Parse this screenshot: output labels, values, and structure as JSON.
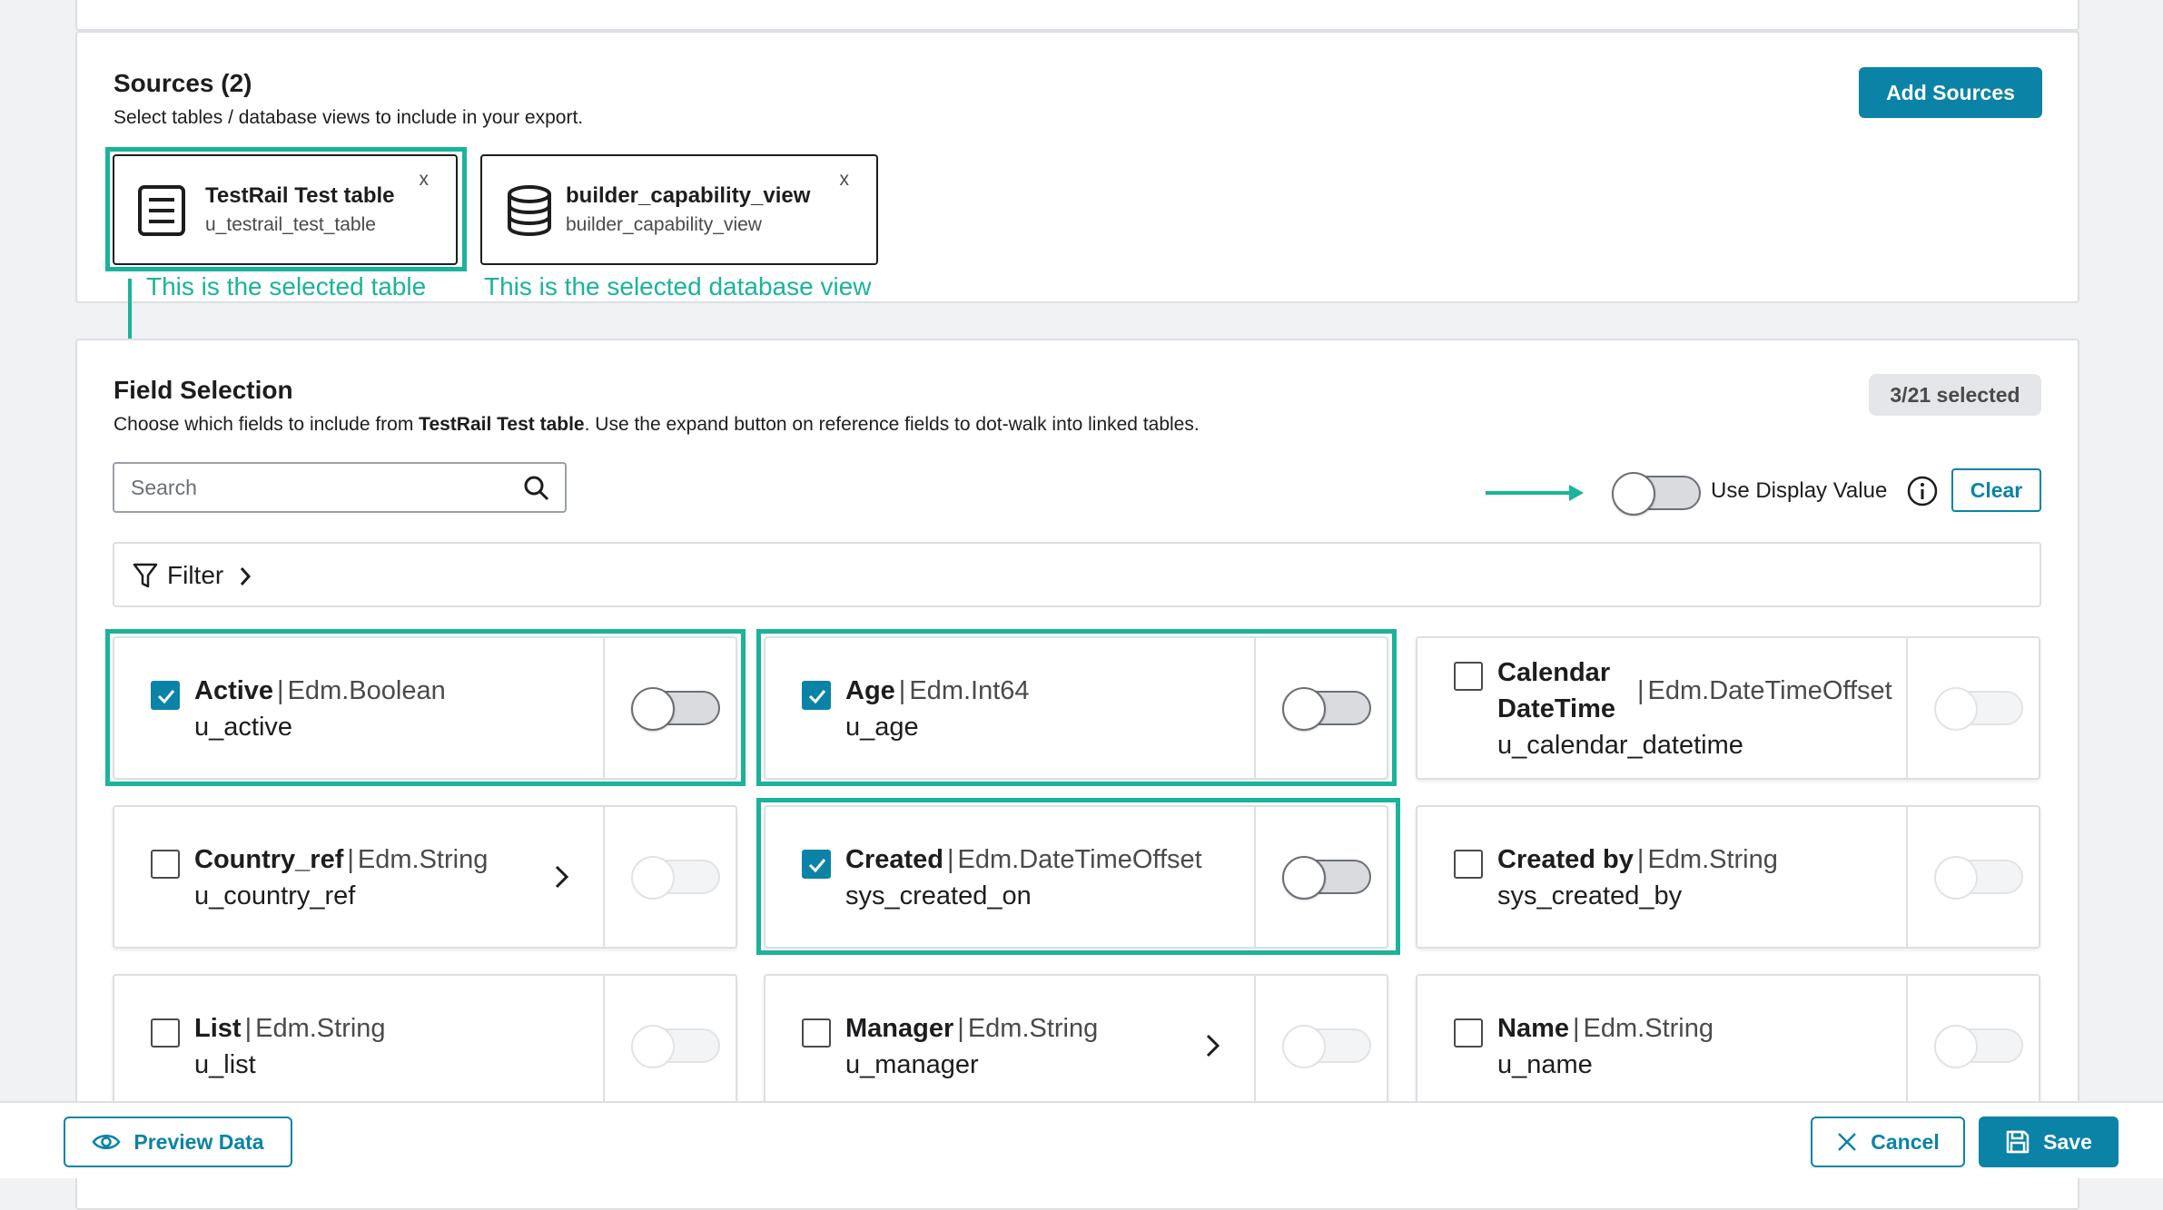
{
  "sources": {
    "title": "Sources (2)",
    "subtitle": "Select tables / database views to include in your export.",
    "add_button": "Add Sources",
    "items": [
      {
        "name": "TestRail Test table",
        "id": "u_testrail_test_table",
        "close": "x",
        "icon": "table-icon"
      },
      {
        "name": "builder_capability_view",
        "id": "builder_capability_view",
        "close": "x",
        "icon": "database-icon"
      }
    ]
  },
  "annotations": {
    "table": "This is the selected table",
    "view": "This is the selected database view",
    "highlight_color": "#1bb39a"
  },
  "fields": {
    "title": "Field Selection",
    "subtitle_pre": "Choose which fields to include from ",
    "subtitle_table": "TestRail Test table",
    "subtitle_post": ". Use the expand button on reference fields to dot-walk into linked tables.",
    "selected_badge": "3/21 selected",
    "search_placeholder": "Search",
    "display_value_label": "Use Display Value",
    "clear_button": "Clear",
    "filter_label": "Filter",
    "items": [
      {
        "name": "Active",
        "type": "Edm.Boolean",
        "id": "u_active",
        "checked": true
      },
      {
        "name": "Age",
        "type": "Edm.Int64",
        "id": "u_age",
        "checked": true
      },
      {
        "name_line1": "Calendar",
        "name_line2": "DateTime",
        "type": "Edm.DateTimeOffset",
        "id": "u_calendar_datetime",
        "checked": false
      },
      {
        "name": "Country_ref",
        "type": "Edm.String",
        "id": "u_country_ref",
        "checked": false,
        "expandable": true
      },
      {
        "name": "Created",
        "type": "Edm.DateTimeOffset",
        "id": "sys_created_on",
        "checked": true
      },
      {
        "name": "Created by",
        "type": "Edm.String",
        "id": "sys_created_by",
        "checked": false
      },
      {
        "name": "List",
        "type": "Edm.String",
        "id": "u_list",
        "checked": false
      },
      {
        "name": "Manager",
        "type": "Edm.String",
        "id": "u_manager",
        "checked": false,
        "expandable": true
      },
      {
        "name": "Name",
        "type": "Edm.String",
        "id": "u_name",
        "checked": false
      }
    ],
    "separator": "|"
  },
  "footer": {
    "preview_button": "Preview Data",
    "cancel_button": "Cancel",
    "save_button": "Save"
  },
  "colors": {
    "accent": "#0b83a6",
    "highlight": "#1bb39a"
  }
}
